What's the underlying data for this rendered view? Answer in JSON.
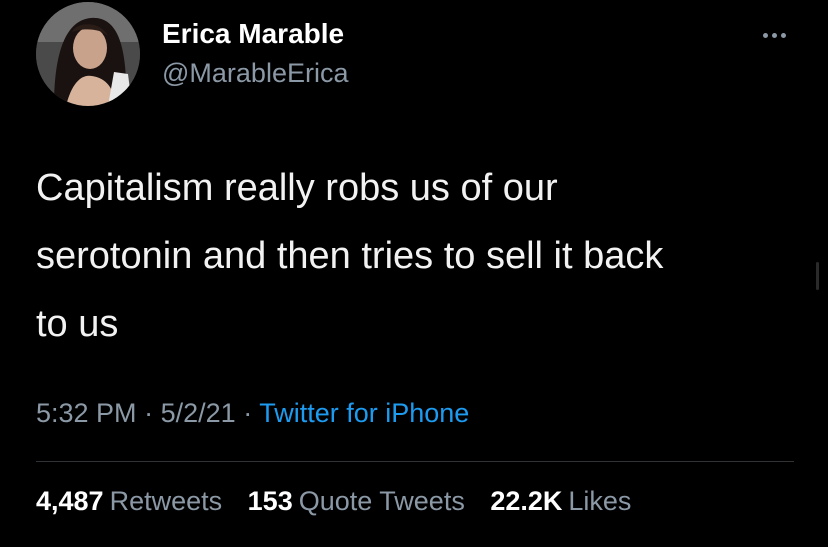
{
  "author": {
    "display_name": "Erica Marable",
    "handle": "@MarableErica"
  },
  "tweet": {
    "lines": [
      "Capitalism really robs us of our",
      "serotonin and then tries to sell it back",
      "to us"
    ]
  },
  "meta": {
    "time": "5:32 PM",
    "separator": "·",
    "date": "5/2/21",
    "source": "Twitter for iPhone"
  },
  "stats": {
    "retweets_count": "4,487",
    "retweets_label": "Retweets",
    "quotes_count": "153",
    "quotes_label": "Quote Tweets",
    "likes_count": "22.2K",
    "likes_label": "Likes"
  },
  "icons": {
    "more": "more-horizontal-icon"
  },
  "colors": {
    "background": "#000000",
    "primary_text": "#ffffff",
    "secondary_text": "#8b98a5",
    "link": "#1d9bf0",
    "divider": "#2f3336"
  }
}
